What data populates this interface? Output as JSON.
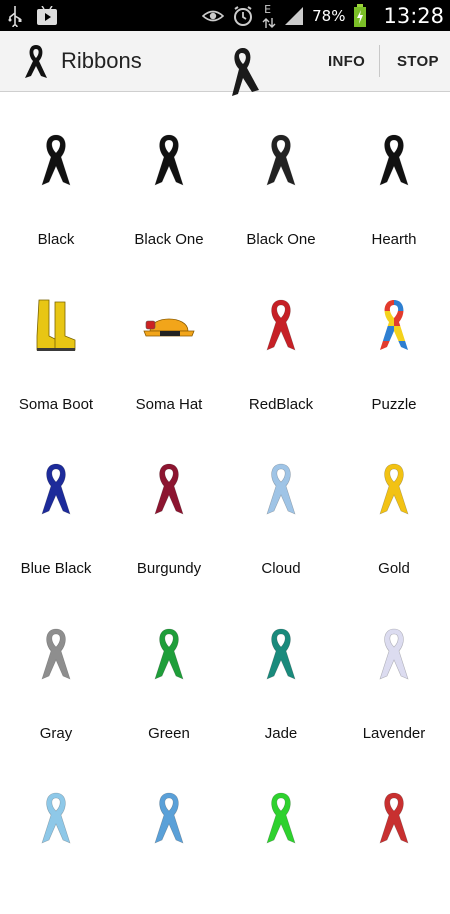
{
  "status_bar": {
    "battery": "78%",
    "time": "13:28",
    "network_letter": "E",
    "icons": [
      "usb-icon",
      "play-store-icon",
      "eye-icon",
      "alarm-icon",
      "data-arrows-icon",
      "signal-icon",
      "battery-charging-icon"
    ]
  },
  "app_bar": {
    "title": "Ribbons",
    "info_label": "INFO",
    "stop_label": "STOP"
  },
  "ribbons": [
    {
      "label": "Black",
      "icon": "black-ribbon-icon",
      "color": "#111111"
    },
    {
      "label": "Black One",
      "icon": "black-one-ribbon-icon",
      "color": "#111111"
    },
    {
      "label": "Black One",
      "icon": "black-one-ribbon-icon",
      "color": "#222222"
    },
    {
      "label": "Hearth",
      "icon": "hearth-ribbon-icon",
      "color": "#111111"
    },
    {
      "label": "Soma Boot",
      "icon": "yellow-boots-icon",
      "color": "#e8c614"
    },
    {
      "label": "Soma Hat",
      "icon": "hard-hat-icon",
      "color": "#f2a51a"
    },
    {
      "label": "RedBlack",
      "icon": "red-black-ribbon-icon",
      "color": "#c62026"
    },
    {
      "label": "Puzzle",
      "icon": "puzzle-ribbon-icon",
      "color": "#e23b2d"
    },
    {
      "label": "Blue Black",
      "icon": "blue-black-ribbon-icon",
      "color": "#1d2b9a"
    },
    {
      "label": "Burgundy",
      "icon": "burgundy-ribbon-icon",
      "color": "#8c1530"
    },
    {
      "label": "Cloud",
      "icon": "cloud-ribbon-icon",
      "color": "#9fc4e6"
    },
    {
      "label": "Gold",
      "icon": "gold-ribbon-icon",
      "color": "#f2c214"
    },
    {
      "label": "Gray",
      "icon": "gray-ribbon-icon",
      "color": "#8e8e8e"
    },
    {
      "label": "Green",
      "icon": "green-ribbon-icon",
      "color": "#1f9e3a"
    },
    {
      "label": "Jade",
      "icon": "jade-ribbon-icon",
      "color": "#1a8a7c"
    },
    {
      "label": "Lavender",
      "icon": "lavender-ribbon-icon",
      "color": "#dcdcf0"
    },
    {
      "label": "",
      "icon": "light-blue-ribbon-icon",
      "color": "#8ec8e8"
    },
    {
      "label": "",
      "icon": "blue-ribbon-icon",
      "color": "#5aa0d8"
    },
    {
      "label": "",
      "icon": "lime-ribbon-icon",
      "color": "#2ed12e"
    },
    {
      "label": "",
      "icon": "red-ribbon-icon",
      "color": "#c83030"
    }
  ]
}
